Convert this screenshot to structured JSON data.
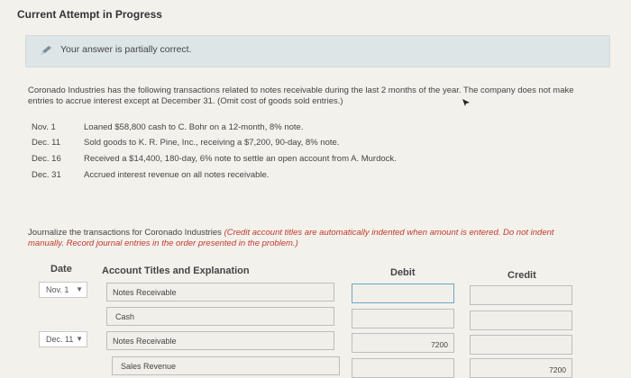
{
  "header": {
    "title": "Current Attempt in Progress"
  },
  "alert": {
    "icon": "pencil-icon",
    "text": "Your answer is partially correct."
  },
  "problem": {
    "description": "Coronado Industries has the following transactions related to notes receivable during the last 2 months of the year. The company does not make entries to accrue interest except at December 31. (Omit cost of goods sold entries.)",
    "transactions": [
      {
        "date": "Nov. 1",
        "text": "Loaned $58,800 cash to C. Bohr on a 12-month, 8% note."
      },
      {
        "date": "Dec. 11",
        "text": "Sold goods to K. R. Pine, Inc., receiving a $7,200, 90-day, 8% note."
      },
      {
        "date": "Dec. 16",
        "text": "Received a $14,400, 180-day, 6% note to settle an open account from A. Murdock."
      },
      {
        "date": "Dec. 31",
        "text": "Accrued interest revenue on all notes receivable."
      }
    ],
    "instructions_prefix": "Journalize the transactions for Coronado Industries",
    "instructions_red": "(Credit account titles are automatically indented when amount is entered. Do not indent manually. Record journal entries in the order presented in the problem.)"
  },
  "journal": {
    "headers": {
      "date": "Date",
      "account": "Account Titles and Explanation",
      "debit": "Debit",
      "credit": "Credit"
    },
    "rows": [
      {
        "date": "Nov. 1",
        "account": "Notes Receivable",
        "debit": "",
        "credit": ""
      },
      {
        "date": "",
        "account": "Cash",
        "debit": "",
        "credit": ""
      },
      {
        "date": "Dec. 11",
        "account": "Notes Receivable",
        "debit": "7200",
        "credit": ""
      },
      {
        "date": "",
        "account": "Sales Revenue",
        "debit": "",
        "credit": "7200"
      }
    ]
  }
}
